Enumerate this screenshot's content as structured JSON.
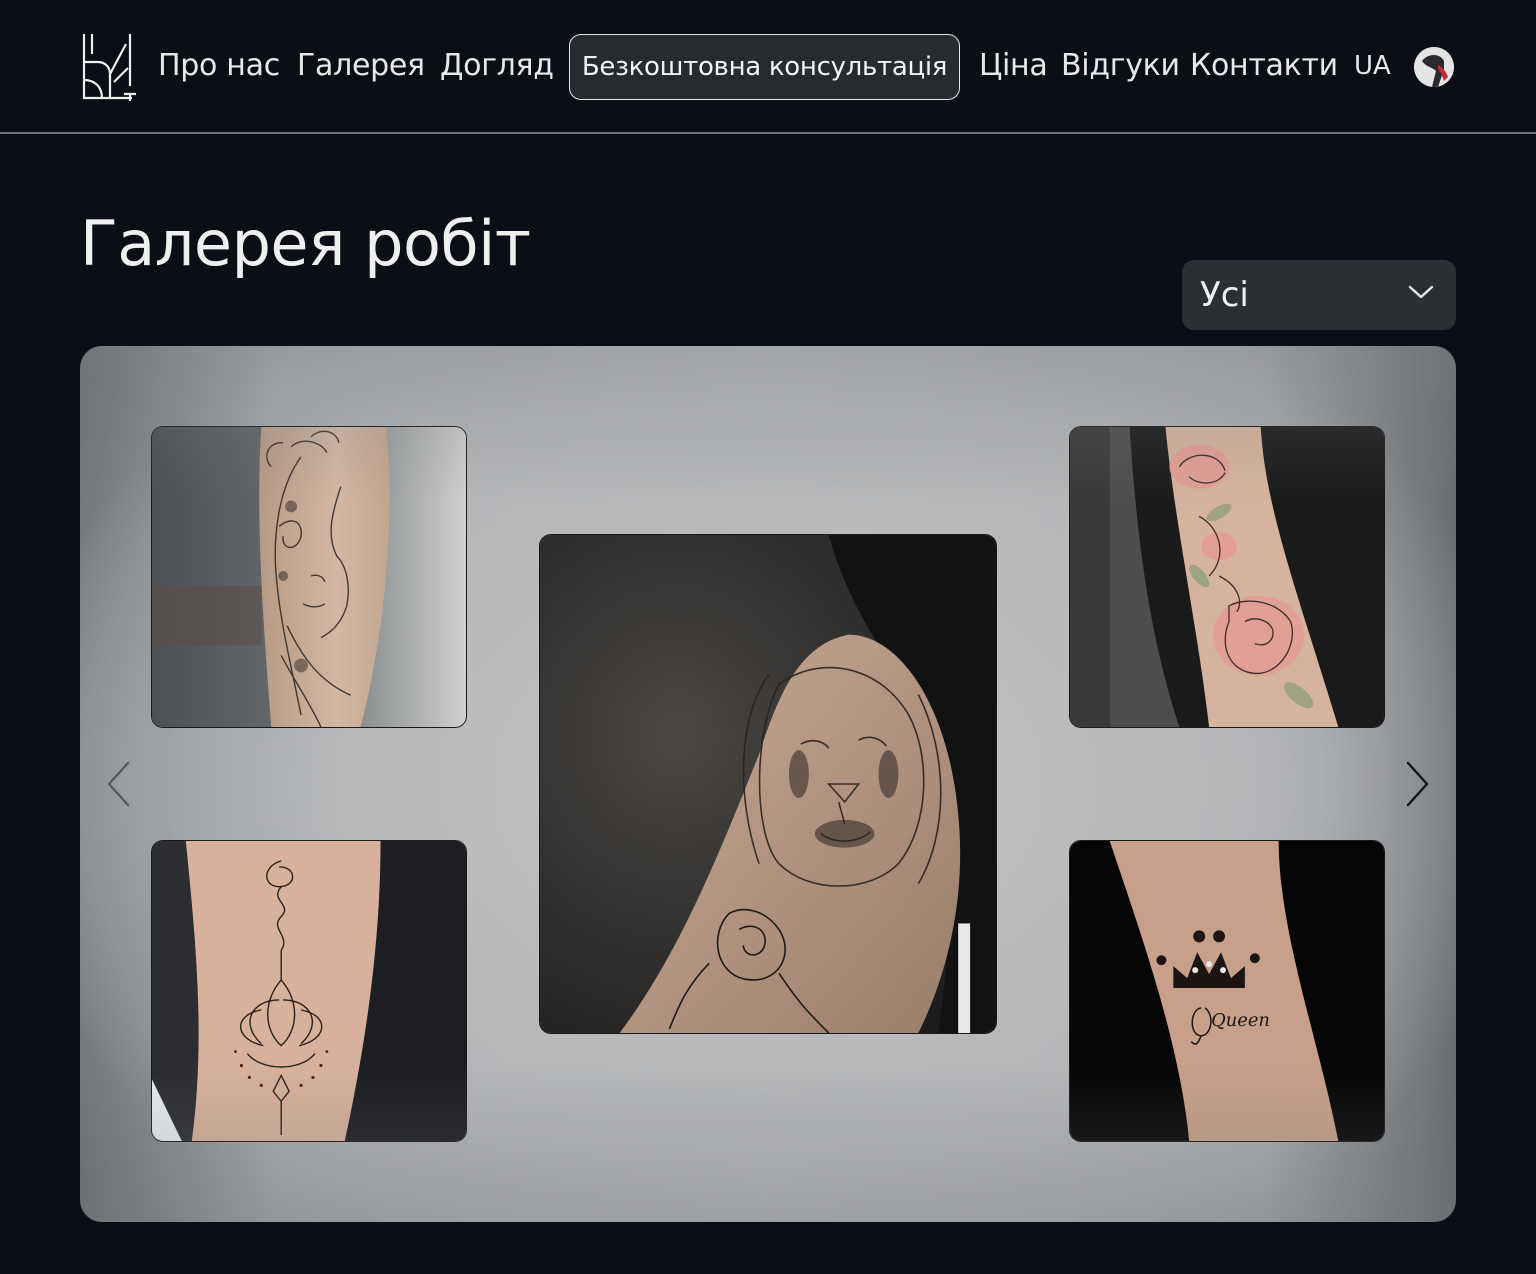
{
  "header": {
    "logo_icon": "studio-monogram-logo",
    "nav": [
      {
        "label": "Про нас"
      },
      {
        "label": "Галерея"
      },
      {
        "label": "Догляд"
      },
      {
        "label": "Безкоштовна консультація"
      },
      {
        "label": "Ціна"
      },
      {
        "label": "Відгуки"
      },
      {
        "label": "Контакти"
      }
    ],
    "language": "UA",
    "avatar_icon": "user-avatar"
  },
  "gallery_section": {
    "title": "Галерея робіт",
    "filter": {
      "selected": "Усі",
      "icon": "chevron-down-icon"
    },
    "prev_icon": "chevron-left-icon",
    "next_icon": "chevron-right-icon",
    "photos": [
      {
        "subject": "medusa-tattoo-photo"
      },
      {
        "subject": "lotus-unalome-tattoo-photo"
      },
      {
        "subject": "lion-rose-tattoo-photo"
      },
      {
        "subject": "peony-tattoo-photo"
      },
      {
        "subject": "crown-queen-tattoo-photo",
        "text": "Queen"
      }
    ]
  },
  "colors": {
    "page_background": "#0b0e14",
    "text": "#ececec",
    "cta_background": "#272b30",
    "dropdown_background": "#2b2e33",
    "gallery_panel": "#b9bbbd"
  }
}
